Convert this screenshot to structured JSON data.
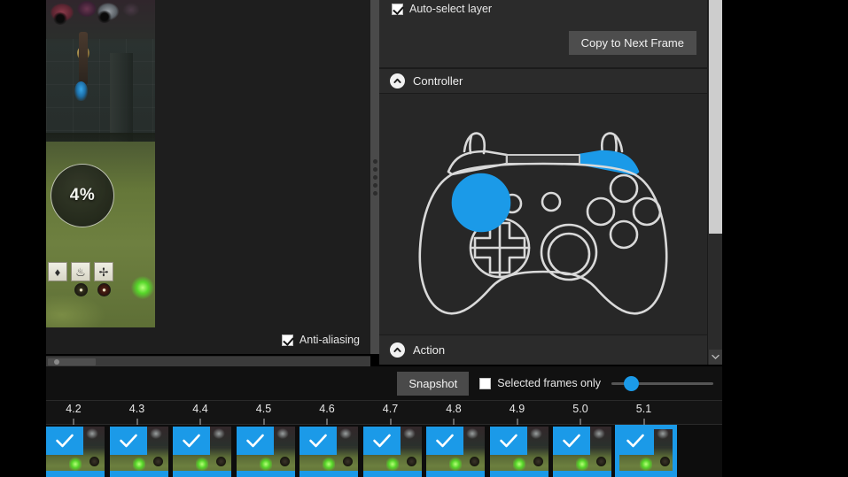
{
  "properties_panel": {
    "auto_select": {
      "label": "Auto-select layer",
      "checked": true
    },
    "copy_button": "Copy to Next Frame",
    "controller_section": {
      "title": "Controller",
      "chevron": "chevron-up-icon"
    },
    "action_section": {
      "title": "Action",
      "chevron": "chevron-up-icon"
    },
    "scrollbar": {
      "down_arrow": "chevron-down-icon"
    }
  },
  "editor": {
    "preview": {
      "progress_label": "4%",
      "hud_icons": [
        "gem-icon",
        "leaf-icon",
        "compass-icon"
      ],
      "hud_coins": [
        "coin-dark-icon",
        "coin-red-icon"
      ]
    },
    "anti_aliasing": {
      "label": "Anti-aliasing",
      "checked": true
    }
  },
  "timeline": {
    "snapshot_button": "Snapshot",
    "selected_frames_only": {
      "label": "Selected frames only",
      "checked": false
    },
    "zoom_slider": {
      "value": 18
    },
    "ruler_ticks": [
      "4.2",
      "4.3",
      "4.4",
      "4.5",
      "4.6",
      "4.7",
      "4.8",
      "4.9",
      "5.0",
      "5.1"
    ],
    "frames": [
      {
        "time": "4.2",
        "checked": true,
        "selected": false
      },
      {
        "time": "4.3",
        "checked": true,
        "selected": false
      },
      {
        "time": "4.4",
        "checked": true,
        "selected": false
      },
      {
        "time": "4.5",
        "checked": true,
        "selected": false
      },
      {
        "time": "4.6",
        "checked": true,
        "selected": false
      },
      {
        "time": "4.7",
        "checked": true,
        "selected": false
      },
      {
        "time": "4.8",
        "checked": true,
        "selected": false
      },
      {
        "time": "4.9",
        "checked": true,
        "selected": false
      },
      {
        "time": "5.0",
        "checked": true,
        "selected": false
      },
      {
        "time": "5.1",
        "checked": true,
        "selected": true
      }
    ]
  },
  "controller_graphic": {
    "highlighted_parts": [
      "left-stick",
      "right-bumper"
    ],
    "accent_color": "#1b9ae8",
    "outline_color": "#d9d9d9"
  },
  "colors": {
    "accent": "#1b9ae8",
    "panel_bg": "#2b2b2b",
    "stage_bg": "#272727",
    "timeline_bg": "#1a1a1a",
    "button_bg": "#4d4d4d",
    "text": "#ededed"
  }
}
